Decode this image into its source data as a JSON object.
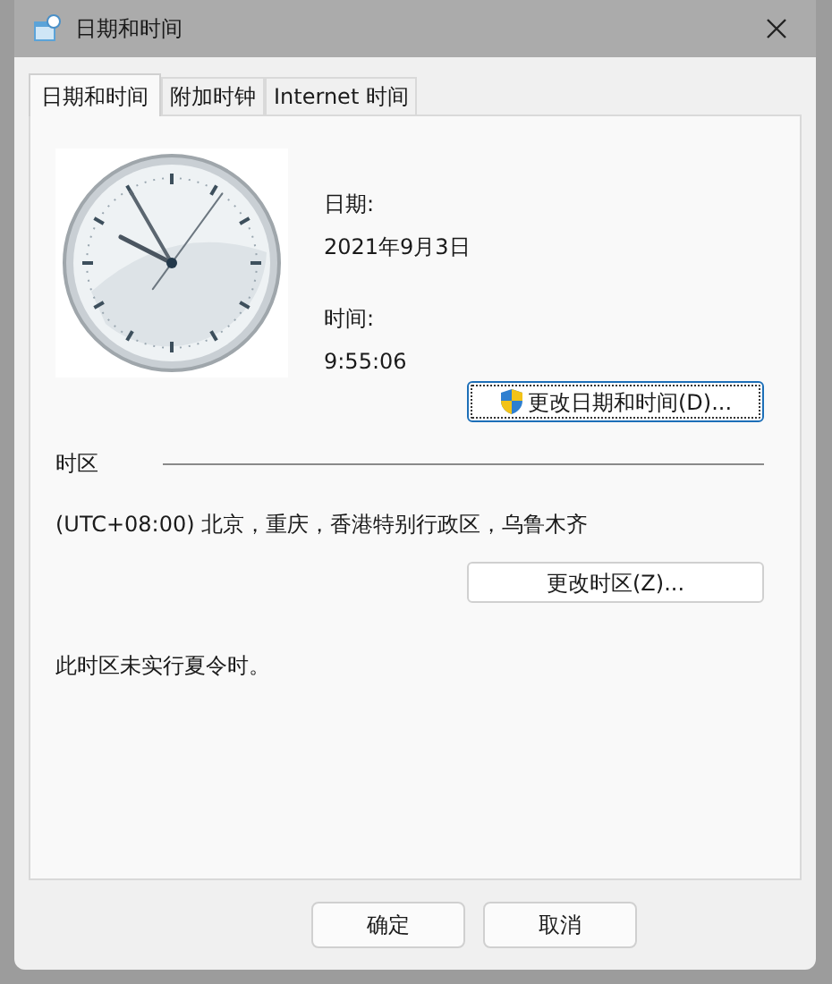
{
  "window": {
    "title": "日期和时间"
  },
  "tabs": [
    {
      "label": "日期和时间",
      "selected": true
    },
    {
      "label": "附加时钟",
      "selected": false
    },
    {
      "label": "Internet 时间",
      "selected": false
    }
  ],
  "date": {
    "label": "日期:",
    "value": "2021年9月3日"
  },
  "time": {
    "label": "时间:",
    "value": "9:55:06"
  },
  "change_datetime_button": "更改日期和时间(D)...",
  "timezone": {
    "heading": "时区",
    "value": "(UTC+08:00) 北京，重庆，香港特别行政区，乌鲁木齐",
    "button": "更改时区(Z)...",
    "dst_note": "此时区未实行夏令时。"
  },
  "buttons": [
    {
      "label": "确定",
      "selected": false
    },
    {
      "label": "取消",
      "selected": false
    }
  ]
}
